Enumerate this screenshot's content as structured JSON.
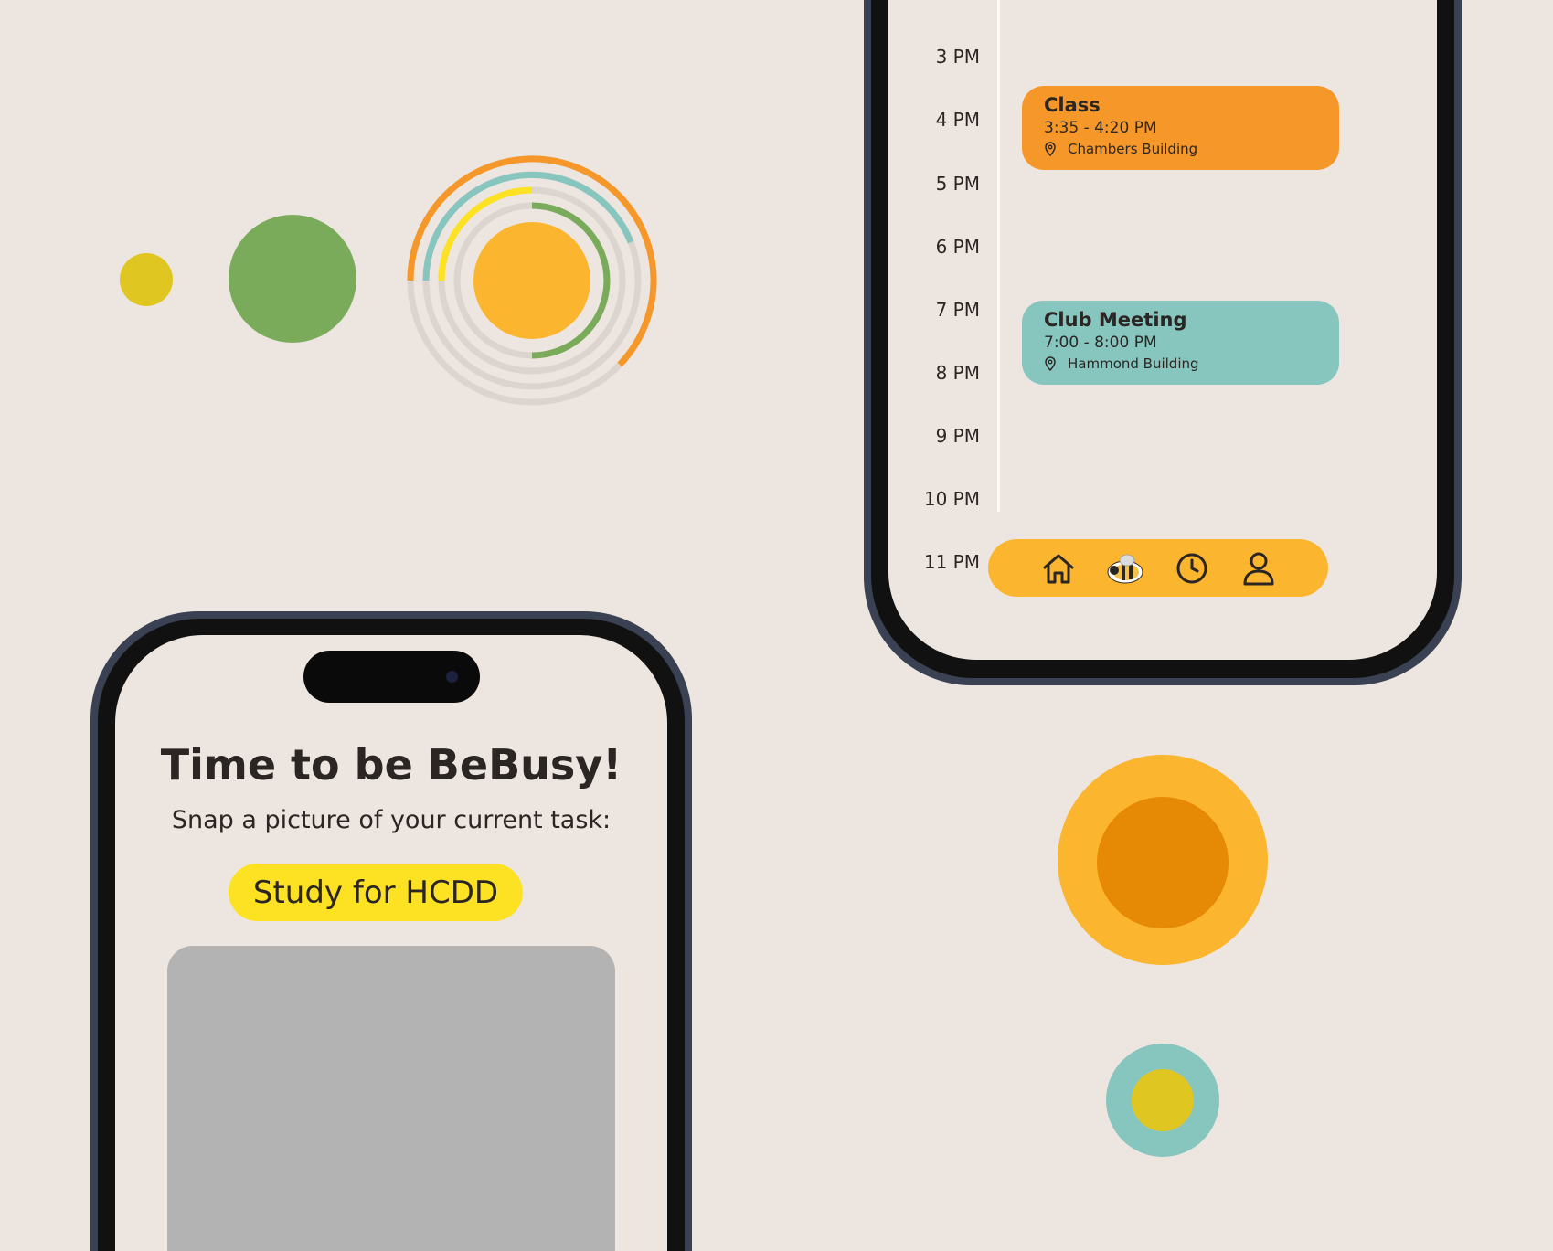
{
  "colors": {
    "background": "#ede5df",
    "orange": "#f6972a",
    "amber": "#fbb52f",
    "dark_orange": "#e68a06",
    "green": "#7aab5a",
    "teal": "#86c6be",
    "mustard": "#dfc621",
    "yellow": "#fde224",
    "gray": "#b3b3b3"
  },
  "schedule": {
    "hours": [
      "3 PM",
      "4 PM",
      "5 PM",
      "6 PM",
      "7 PM",
      "8 PM",
      "9 PM",
      "10 PM",
      "11 PM"
    ],
    "events": [
      {
        "title": "Class",
        "time": "3:35 - 4:20 PM",
        "location": "Chambers Building",
        "color": "#f6972a"
      },
      {
        "title": "Club Meeting",
        "time": "7:00 - 8:00 PM",
        "location": "Hammond Building",
        "color": "#86c6be"
      }
    ],
    "nav": [
      {
        "icon": "home-icon"
      },
      {
        "icon": "bee-icon"
      },
      {
        "icon": "clock-icon"
      },
      {
        "icon": "profile-icon"
      }
    ]
  },
  "capture": {
    "title": "Time to be BeBusy!",
    "subtitle": "Snap a picture of your current task:",
    "task": "Study for HCDD"
  }
}
